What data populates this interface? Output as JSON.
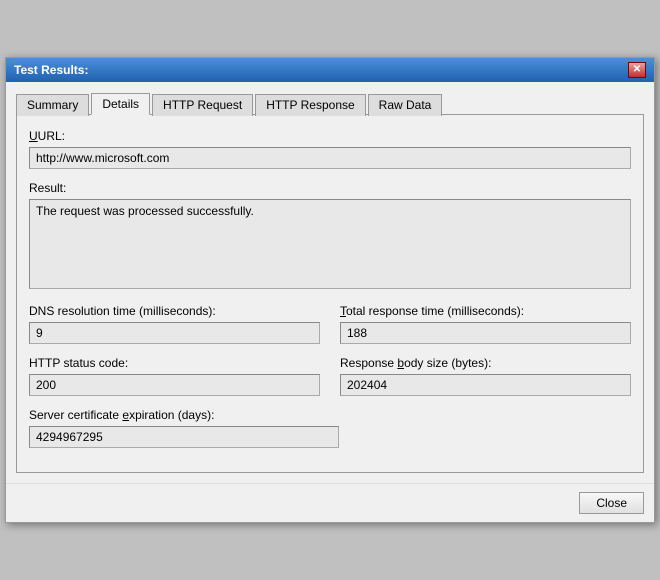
{
  "window": {
    "title": "Test Results:",
    "close_btn": "✕"
  },
  "tabs": [
    {
      "label": "Summary",
      "active": false
    },
    {
      "label": "Details",
      "active": true
    },
    {
      "label": "HTTP Request",
      "active": false
    },
    {
      "label": "HTTP Response",
      "active": false
    },
    {
      "label": "Raw Data",
      "active": false
    }
  ],
  "fields": {
    "url_label": "URL:",
    "url_value": "http://www.microsoft.com",
    "result_label": "Result:",
    "result_value": "The request was processed successfully.",
    "dns_label": "DNS resolution time (milliseconds):",
    "dns_value": "9",
    "total_response_label": "Total response time (milliseconds):",
    "total_response_value": "188",
    "http_status_label": "HTTP status code:",
    "http_status_value": "200",
    "response_body_label": "Response body size (bytes):",
    "response_body_value": "202404",
    "cert_label": "Server certificate expiration (days):",
    "cert_value": "4294967295"
  },
  "footer": {
    "close_label": "Close"
  }
}
